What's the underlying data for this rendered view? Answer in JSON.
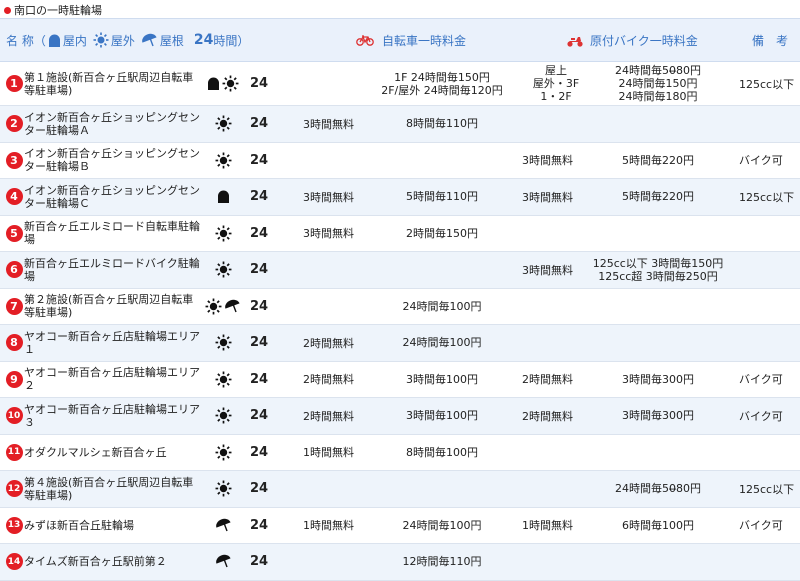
{
  "caption": "南口の一時駐輪場",
  "header": {
    "name_prefix": "名 称（",
    "indoor": "屋内",
    "outdoor": "屋外",
    "roof": "屋根",
    "h24": "24",
    "h24_suffix": "時間）",
    "bicycle": "自転車一時料金",
    "moped": "原付バイク一時料金",
    "notes": "備　考"
  },
  "rows": [
    {
      "no": "1",
      "name": "第１施設(新百合ヶ丘駅周辺自転車等駐車場)",
      "icons": [
        "indoor",
        "outdoor"
      ],
      "h24": "24",
      "bike_free": "",
      "bike_fee": [
        "1F 24時間毎150円",
        "2F/屋外 24時間毎120円"
      ],
      "moto_free": "",
      "moto_tag": [
        "屋上",
        "屋外・3F",
        "1・2F"
      ],
      "moto_fee": [
        "24時間毎50̶80円",
        "24時間毎150円",
        "24時間毎180円"
      ],
      "note": "125cc以下"
    },
    {
      "no": "2",
      "name": "イオン新百合ヶ丘ショッピングセンター駐輪場Ａ",
      "icons": [
        "outdoor"
      ],
      "h24": "24",
      "bike_free": "3時間無料",
      "bike_fee": [
        "8時間毎110円"
      ],
      "moto_free": "",
      "moto_tag": [],
      "moto_fee": [],
      "note": ""
    },
    {
      "no": "3",
      "name": "イオン新百合ヶ丘ショッピングセンター駐輪場Ｂ",
      "icons": [
        "outdoor"
      ],
      "h24": "24",
      "bike_free": "",
      "bike_fee": [],
      "moto_free": "3時間無料",
      "moto_tag": [],
      "moto_fee": [
        "5時間毎220円"
      ],
      "note": "バイク可"
    },
    {
      "no": "4",
      "name": "イオン新百合ヶ丘ショッピングセンター駐輪場Ｃ",
      "icons": [
        "indoor"
      ],
      "h24": "24",
      "bike_free": "3時間無料",
      "bike_fee": [
        "5時間毎110円"
      ],
      "moto_free": "3時間無料",
      "moto_tag": [],
      "moto_fee": [
        "5時間毎220円"
      ],
      "note": "125cc以下"
    },
    {
      "no": "5",
      "name": "新百合ヶ丘エルミロード自転車駐輪場",
      "icons": [
        "outdoor"
      ],
      "h24": "24",
      "bike_free": "3時間無料",
      "bike_fee": [
        "2時間毎150円"
      ],
      "moto_free": "",
      "moto_tag": [],
      "moto_fee": [],
      "note": ""
    },
    {
      "no": "6",
      "name": "新百合ヶ丘エルミロードバイク駐輪場",
      "icons": [
        "outdoor"
      ],
      "h24": "24",
      "bike_free": "",
      "bike_fee": [],
      "moto_free": "3時間無料",
      "moto_tag": [],
      "moto_fee": [
        "125cc以下 3時間毎150円",
        "125cc超 3時間毎250円"
      ],
      "note": ""
    },
    {
      "no": "7",
      "name": "第２施設(新百合ヶ丘駅周辺自転車等駐車場)",
      "icons": [
        "outdoor",
        "roof"
      ],
      "h24": "24",
      "bike_free": "",
      "bike_fee": [
        "24時間毎100円"
      ],
      "moto_free": "",
      "moto_tag": [],
      "moto_fee": [],
      "note": ""
    },
    {
      "no": "8",
      "name": "ヤオコー新百合ヶ丘店駐輪場エリア１",
      "icons": [
        "outdoor"
      ],
      "h24": "24",
      "bike_free": "2時間無料",
      "bike_fee": [
        "24時間毎100円"
      ],
      "moto_free": "",
      "moto_tag": [],
      "moto_fee": [],
      "note": ""
    },
    {
      "no": "9",
      "name": "ヤオコー新百合ヶ丘店駐輪場エリア２",
      "icons": [
        "outdoor"
      ],
      "h24": "24",
      "bike_free": "2時間無料",
      "bike_fee": [
        "3時間毎100円"
      ],
      "moto_free": "2時間無料",
      "moto_tag": [],
      "moto_fee": [
        "3時間毎300円"
      ],
      "note": "バイク可"
    },
    {
      "no": "10",
      "name": "ヤオコー新百合ヶ丘店駐輪場エリア３",
      "icons": [
        "outdoor"
      ],
      "h24": "24",
      "bike_free": "2時間無料",
      "bike_fee": [
        "3時間毎100円"
      ],
      "moto_free": "2時間無料",
      "moto_tag": [],
      "moto_fee": [
        "3時間毎300円"
      ],
      "note": "バイク可"
    },
    {
      "no": "11",
      "name": "オダクルマルシェ新百合ヶ丘",
      "icons": [
        "outdoor"
      ],
      "h24": "24",
      "bike_free": "1時間無料",
      "bike_fee": [
        "8時間毎100円"
      ],
      "moto_free": "",
      "moto_tag": [],
      "moto_fee": [],
      "note": ""
    },
    {
      "no": "12",
      "name": "第４施設(新百合ヶ丘駅周辺自転車等駐車場)",
      "icons": [
        "outdoor"
      ],
      "h24": "24",
      "bike_free": "",
      "bike_fee": [],
      "moto_free": "",
      "moto_tag": [],
      "moto_fee": [
        "24時間毎50̶80円"
      ],
      "note": "125cc以下"
    },
    {
      "no": "13",
      "name": "みずほ新百合丘駐輪場",
      "icons": [
        "roof"
      ],
      "h24": "24",
      "bike_free": "1時間無料",
      "bike_fee": [
        "24時間毎100円"
      ],
      "moto_free": "1時間無料",
      "moto_tag": [],
      "moto_fee": [
        "6時間毎100円"
      ],
      "note": "バイク可"
    },
    {
      "no": "14",
      "name": "タイムズ新百合ヶ丘駅前第２",
      "icons": [
        "roof"
      ],
      "h24": "24",
      "bike_free": "",
      "bike_fee": [
        "12時間毎110円"
      ],
      "moto_free": "",
      "moto_tag": [],
      "moto_fee": [],
      "note": ""
    }
  ],
  "colors": {
    "accent": "#3a75c4",
    "number_circle": "#e31e25",
    "header_bg": "#eaf1fb",
    "row_alt": "#eef4fb"
  }
}
